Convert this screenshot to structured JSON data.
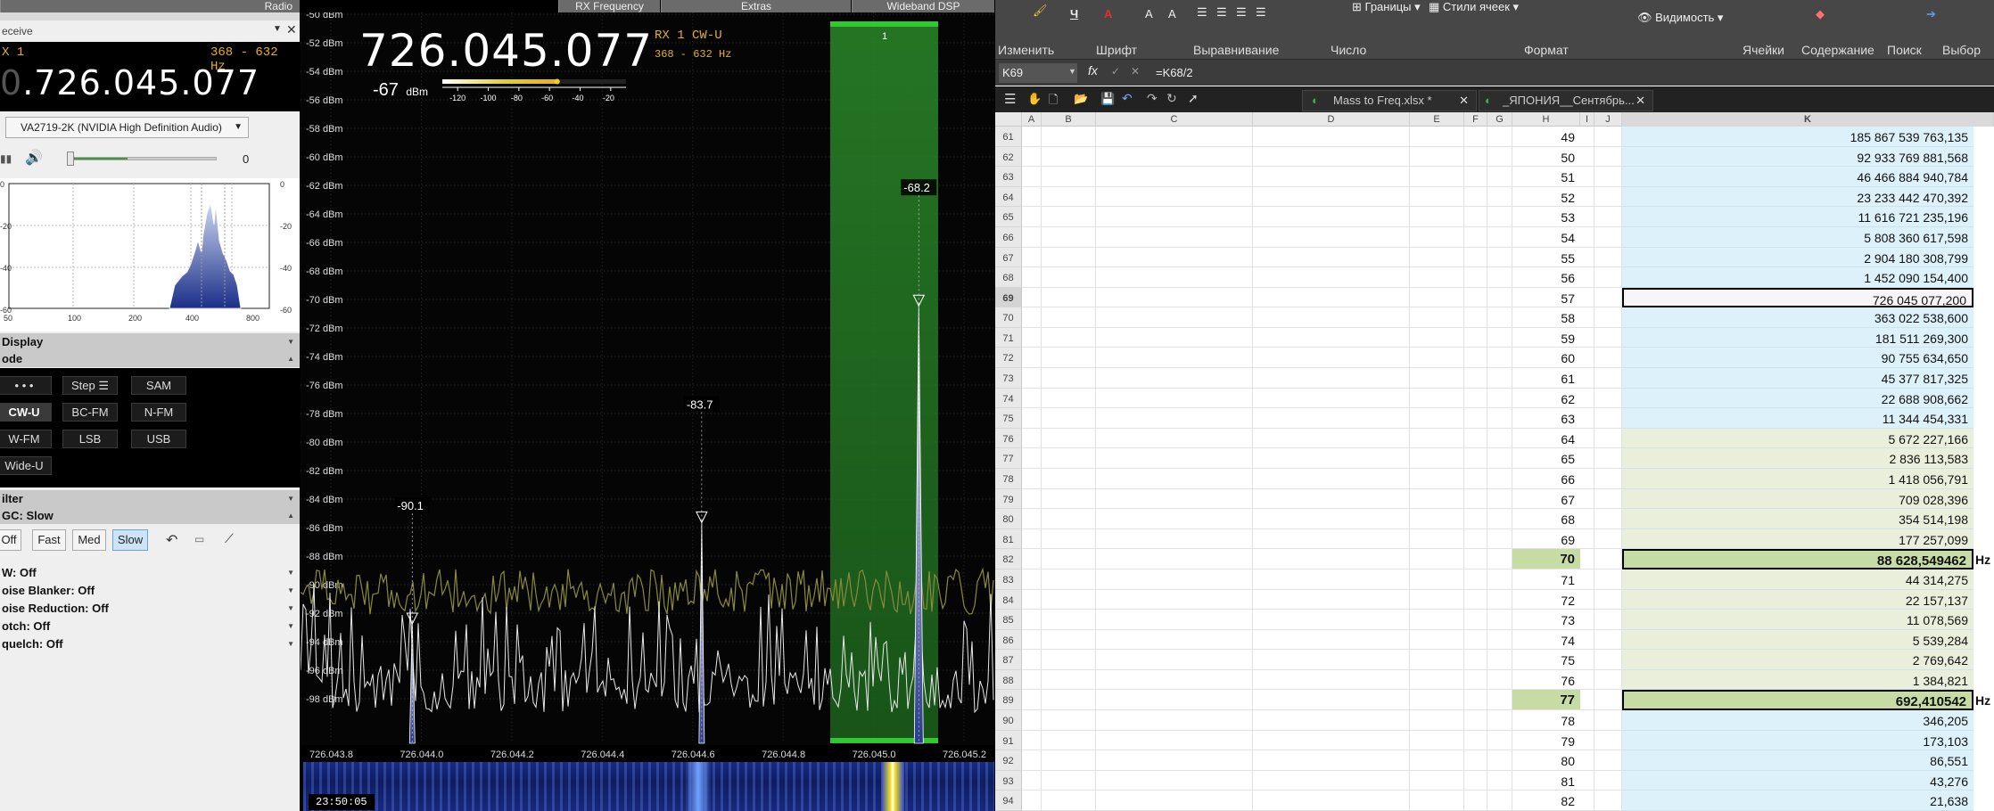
{
  "sdr": {
    "top_tabs": [
      "Radio",
      "RX Frequency",
      "Extras",
      "Wideband DSP"
    ],
    "receive_label": "eceive",
    "rx_label": "X 1",
    "bandwidth": "368 - 632 Hz",
    "freq_dim": "0",
    "freq": ".726.045.077",
    "audio_device": "VA2719-2K (NVIDIA High Definition Audio)",
    "volume_value": "0",
    "mini_spectrum": {
      "y_ticks_left": [
        "0",
        "-20",
        "-40",
        "-60"
      ],
      "y_ticks_right": [
        "0",
        "-20",
        "-40",
        "-60"
      ],
      "x_ticks": [
        "50",
        "100",
        "200",
        "400",
        "800"
      ]
    },
    "sections": {
      "display": "Display",
      "mode": "ode"
    },
    "mode_buttons": {
      "dots": "• • •",
      "step": "Step ☰",
      "sam": "SAM",
      "cwu": "CW-U",
      "bcfm": "BC-FM",
      "nfm": "N-FM",
      "wfm": "W-FM",
      "lsb": "LSB",
      "usb": "USB",
      "wideu": "Wide-U"
    },
    "filter_label": "ilter",
    "agc_label": "GC: Slow",
    "agc_buttons": {
      "off": "Off",
      "fast": "Fast",
      "med": "Med",
      "slow": "Slow"
    },
    "options": {
      "nr": "W: Off",
      "nb": "oise Blanker: Off",
      "noise_red": "oise Reduction: Off",
      "notch": "otch: Off",
      "squelch": "quelch: Off"
    }
  },
  "spectrum": {
    "big_freq": "726.045.077",
    "rx_line1": "RX 1   CW-U",
    "rx_line2": "368 - 632 Hz",
    "smeter_value": "-67",
    "smeter_unit": "dBm",
    "smeter_level_dbm": -55,
    "smeter_ticks": [
      "-120",
      "-100",
      "-80",
      "-60",
      "-40",
      "-20"
    ],
    "db_labels": [
      "-50 dBm",
      "-52 dBm",
      "-54 dBm",
      "-56 dBm",
      "-58 dBm",
      "-60 dBm",
      "-62 dBm",
      "-64 dBm",
      "-66 dBm",
      "-68 dBm",
      "-70 dBm",
      "-72 dBm",
      "-74 dBm",
      "-76 dBm",
      "-78 dBm",
      "-80 dBm",
      "-82 dBm",
      "-84 dBm",
      "-86 dBm",
      "-88 dBm",
      "-90 dBm",
      "-92 dBm",
      "-94 dBm",
      "-96 dBm",
      "-98 dBm"
    ],
    "freq_ticks": [
      "726.043.8",
      "726.044.0",
      "726.044.2",
      "726.044.4",
      "726.044.6",
      "726.044.8",
      "726.045.0",
      "726.045.2"
    ],
    "markers": [
      {
        "label": "-68.2",
        "freq_khz": 726045.1,
        "dbm": -70.2
      },
      {
        "label": "-83.7",
        "freq_khz": 726044.62,
        "dbm": -85.4
      },
      {
        "label": "-90.1",
        "freq_khz": 726043.98,
        "dbm": -92.5
      }
    ],
    "channel_number": "1",
    "waterfall_time": "23:50:05"
  },
  "excel": {
    "ribbon_items": {
      "borders": "Границы",
      "cell_styles": "Стили ячеек",
      "visibility": "Видимость"
    },
    "ribbon_groups": [
      "Изменить",
      "Шрифт",
      "Выравнивание",
      "Число",
      "Формат",
      "Ячейки",
      "Содержание",
      "Поиск",
      "Выбор"
    ],
    "name_box": "K69",
    "formula": "=K68/2",
    "file_tabs": [
      "Mass to Freq.xlsx *",
      "_ЯПОНИЯ__Сентябрь..."
    ],
    "columns": [
      "A",
      "B",
      "C",
      "D",
      "E",
      "F",
      "G",
      "H",
      "I",
      "J",
      "K"
    ],
    "unit_hz": "Hz",
    "rows": [
      {
        "r": "61",
        "h": "49",
        "k": "185 867 539 763,135",
        "style": "blue"
      },
      {
        "r": "62",
        "h": "50",
        "k": "92 933 769 881,568",
        "style": "blue"
      },
      {
        "r": "63",
        "h": "51",
        "k": "46 466 884 940,784",
        "style": "blue"
      },
      {
        "r": "64",
        "h": "52",
        "k": "23 233 442 470,392",
        "style": "blue"
      },
      {
        "r": "65",
        "h": "53",
        "k": "11 616 721 235,196",
        "style": "blue"
      },
      {
        "r": "66",
        "h": "54",
        "k": "5 808 360 617,598",
        "style": "blue"
      },
      {
        "r": "67",
        "h": "55",
        "k": "2 904 180 308,799",
        "style": "blue"
      },
      {
        "r": "68",
        "h": "56",
        "k": "1 452 090 154,400",
        "style": "blue"
      },
      {
        "r": "69",
        "h": "57",
        "k": "726 045 077,200",
        "style": "sel"
      },
      {
        "r": "70",
        "h": "58",
        "k": "363 022 538,600",
        "style": "blue"
      },
      {
        "r": "71",
        "h": "59",
        "k": "181 511 269,300",
        "style": "blue"
      },
      {
        "r": "72",
        "h": "60",
        "k": "90 755 634,650",
        "style": "blue"
      },
      {
        "r": "73",
        "h": "61",
        "k": "45 377 817,325",
        "style": "blue"
      },
      {
        "r": "74",
        "h": "62",
        "k": "22 688 908,662",
        "style": "blue"
      },
      {
        "r": "75",
        "h": "63",
        "k": "11 344 454,331",
        "style": "blue"
      },
      {
        "r": "76",
        "h": "64",
        "k": "5 672 227,166",
        "style": "olive"
      },
      {
        "r": "77",
        "h": "65",
        "k": "2 836 113,583",
        "style": "olive"
      },
      {
        "r": "78",
        "h": "66",
        "k": "1 418 056,791",
        "style": "olive"
      },
      {
        "r": "79",
        "h": "67",
        "k": "709 028,396",
        "style": "olive"
      },
      {
        "r": "80",
        "h": "68",
        "k": "354 514,198",
        "style": "olive"
      },
      {
        "r": "81",
        "h": "69",
        "k": "177 257,099",
        "style": "olive"
      },
      {
        "r": "82",
        "h": "70",
        "k": "88 628,549462",
        "style": "hl"
      },
      {
        "r": "83",
        "h": "71",
        "k": "44 314,275",
        "style": "olive"
      },
      {
        "r": "84",
        "h": "72",
        "k": "22 157,137",
        "style": "olive"
      },
      {
        "r": "85",
        "h": "73",
        "k": "11 078,569",
        "style": "olive"
      },
      {
        "r": "86",
        "h": "74",
        "k": "5 539,284",
        "style": "olive"
      },
      {
        "r": "87",
        "h": "75",
        "k": "2 769,642",
        "style": "olive"
      },
      {
        "r": "88",
        "h": "76",
        "k": "1 384,821",
        "style": "olive"
      },
      {
        "r": "89",
        "h": "77",
        "k": "692,410542",
        "style": "hl"
      },
      {
        "r": "90",
        "h": "78",
        "k": "346,205",
        "style": "blue"
      },
      {
        "r": "91",
        "h": "79",
        "k": "173,103",
        "style": "blue"
      },
      {
        "r": "92",
        "h": "80",
        "k": "86,551",
        "style": "blue"
      },
      {
        "r": "93",
        "h": "81",
        "k": "43,276",
        "style": "blue"
      },
      {
        "r": "94",
        "h": "82",
        "k": "21,638",
        "style": "blue"
      }
    ]
  },
  "colors": {
    "accent_gold": "#e5b020",
    "passband_green": "#2a8a2a",
    "excel_blue": "#dcf1fa",
    "excel_olive": "#eaefdc",
    "excel_highlight": "#c7dca5"
  }
}
